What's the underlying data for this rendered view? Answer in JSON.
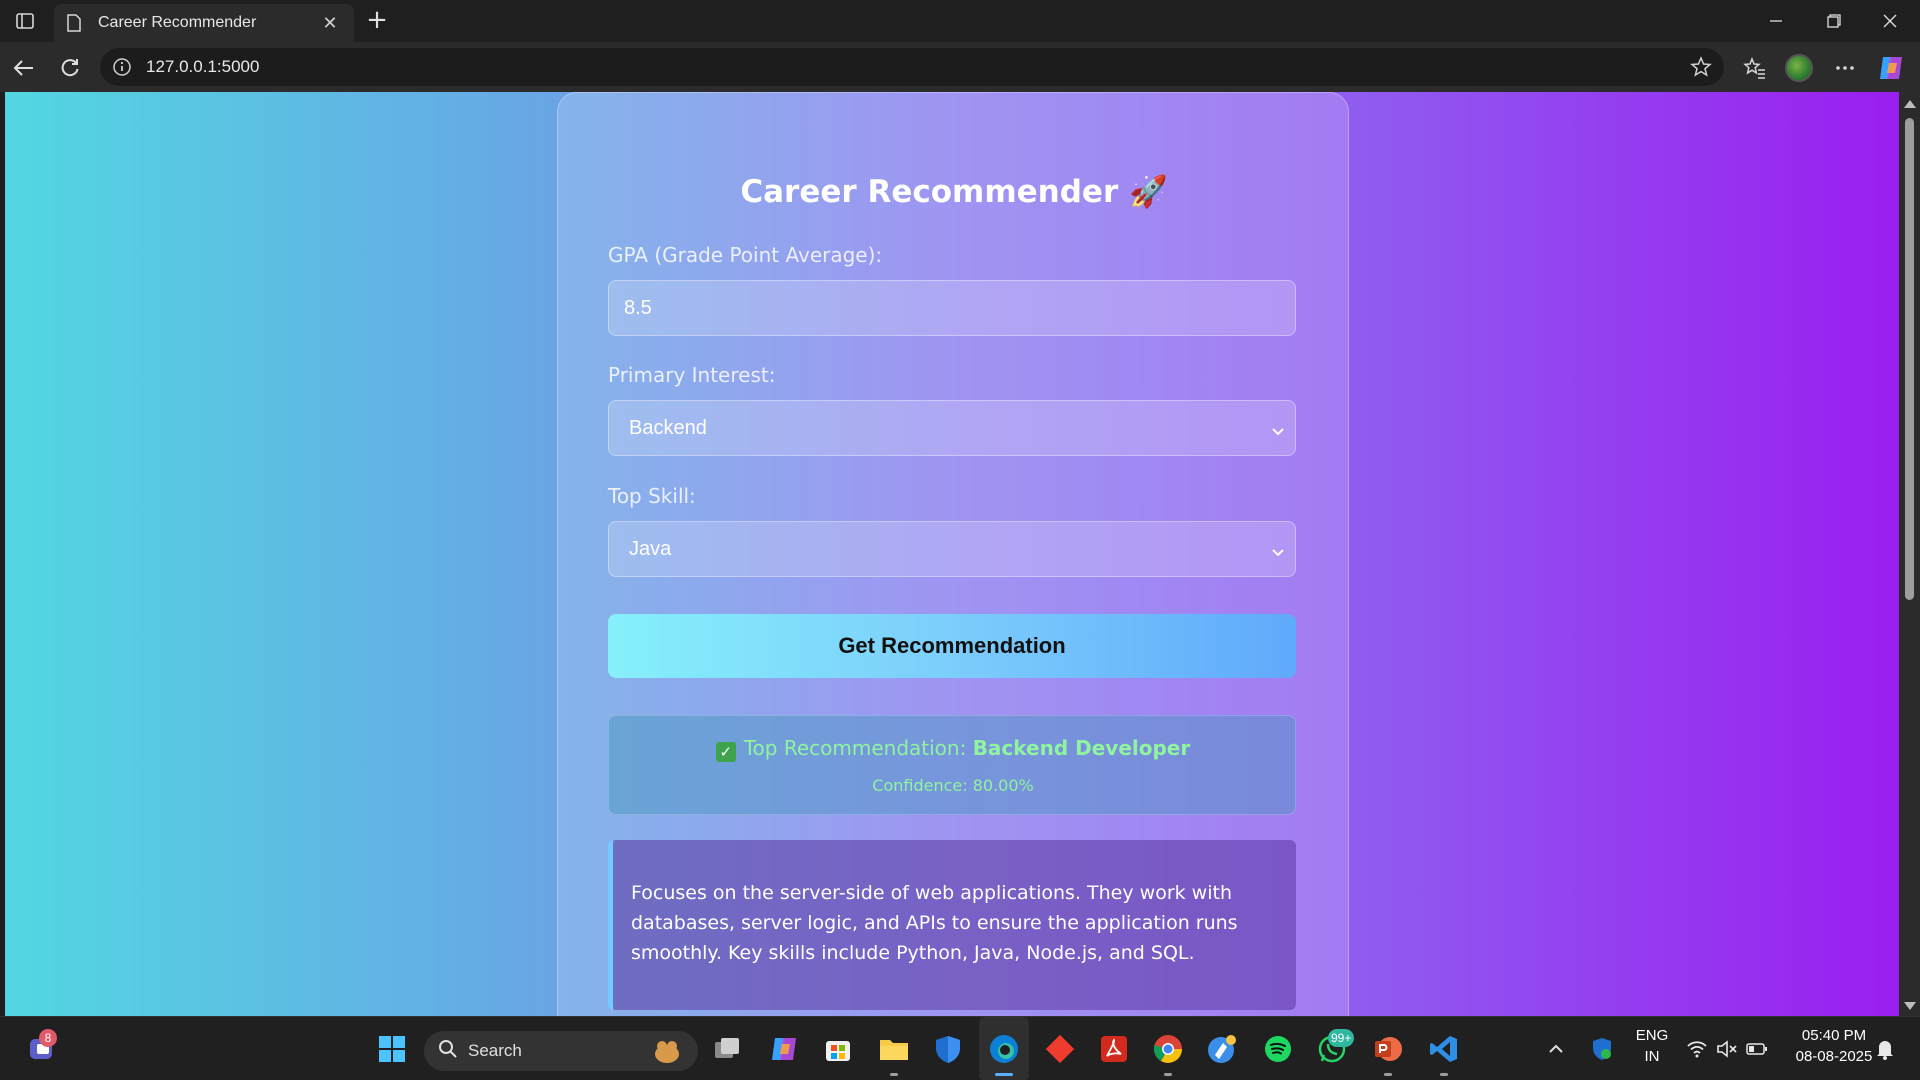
{
  "browser": {
    "tab_title": "Career Recommender",
    "tab_close": "✕",
    "new_tab": "+",
    "url": "127.0.0.1:5000"
  },
  "app": {
    "title": "Career Recommender 🚀",
    "gpa_label": "GPA (Grade Point Average):",
    "gpa_value": "8.5",
    "interest_label": "Primary Interest:",
    "interest_value": "Backend",
    "skill_label": "Top Skill:",
    "skill_value": "Java",
    "button_label": "Get Recommendation",
    "result": {
      "check": "✓",
      "prefix": "Top Recommendation:",
      "career": "Backend Developer",
      "confidence": "Confidence: 80.00%"
    },
    "description": "Focuses on the server-side of web applications. They work with databases, server logic, and APIs to ensure the application runs smoothly. Key skills include Python, Java, Node.js, and SQL."
  },
  "taskbar": {
    "search_placeholder": "Search",
    "teams_badge": "8",
    "whatsapp_badge": "99+",
    "language": "ENG",
    "region": "IN",
    "time": "05:40 PM",
    "date": "08-08-2025"
  },
  "colors": {
    "gradient_start": "#52d7e2",
    "gradient_end": "#9a1ef0",
    "button_start": "#86f0fb",
    "button_end": "#60a9fb",
    "result_text": "#8ff3a0",
    "description_accent": "#72c8ff"
  },
  "icons": {
    "browser": [
      "sidebar-icon",
      "page-icon",
      "close-icon",
      "plus-icon",
      "minimize-icon",
      "restore-icon",
      "window-close-icon",
      "back-icon",
      "refresh-icon",
      "info-icon",
      "star-icon",
      "favorites-icon",
      "more-icon",
      "copilot-icon"
    ],
    "taskbar": [
      "teams-icon",
      "windows-start-icon",
      "search-icon",
      "task-view-icon",
      "copilot-icon",
      "store-icon",
      "file-explorer-icon",
      "defender-icon",
      "edge-icon",
      "git-icon",
      "acrobat-icon",
      "chrome-icon",
      "app-icon",
      "spotify-icon",
      "whatsapp-icon",
      "powerpoint-icon",
      "vscode-icon",
      "chevron-up-icon",
      "security-icon",
      "wifi-icon",
      "mute-icon",
      "battery-icon",
      "notification-icon"
    ]
  }
}
